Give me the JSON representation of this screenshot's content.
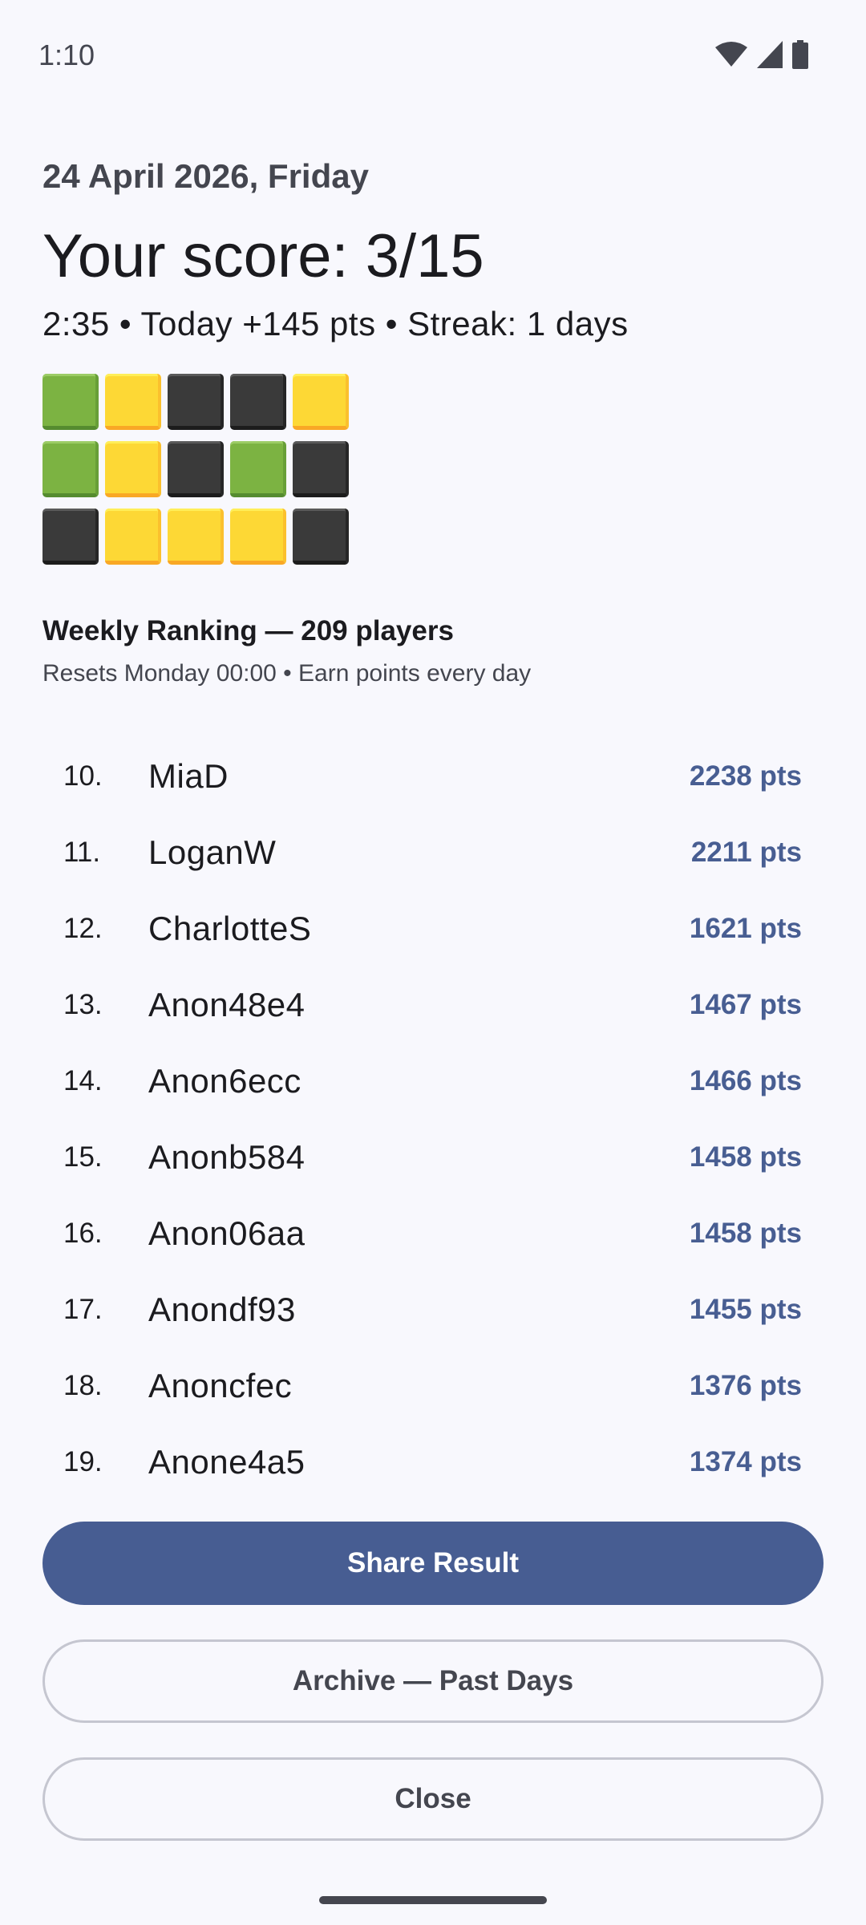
{
  "status_bar": {
    "time": "1:10",
    "icons": [
      "wifi-icon",
      "cell-signal-icon",
      "battery-icon"
    ]
  },
  "header": {
    "date": "24 April 2026, Friday",
    "score": "Your score: 3/15",
    "meta": "2:35 • Today +145 pts • Streak: 1 days"
  },
  "result_grid": [
    [
      "green",
      "yellow",
      "black",
      "black",
      "yellow"
    ],
    [
      "green",
      "yellow",
      "black",
      "green",
      "black"
    ],
    [
      "black",
      "yellow",
      "yellow",
      "yellow",
      "black"
    ]
  ],
  "ranking": {
    "title": "Weekly Ranking — 209 players",
    "subtitle": "Resets Monday 00:00 • Earn points every day",
    "rows": [
      {
        "rank": "10.",
        "name": "MiaD",
        "points": "2238 pts"
      },
      {
        "rank": "11.",
        "name": "LoganW",
        "points": "2211 pts"
      },
      {
        "rank": "12.",
        "name": "CharlotteS",
        "points": "1621 pts"
      },
      {
        "rank": "13.",
        "name": "Anon48e4",
        "points": "1467 pts"
      },
      {
        "rank": "14.",
        "name": "Anon6ecc",
        "points": "1466 pts"
      },
      {
        "rank": "15.",
        "name": "Anonb584",
        "points": "1458 pts"
      },
      {
        "rank": "16.",
        "name": "Anon06aa",
        "points": "1458 pts"
      },
      {
        "rank": "17.",
        "name": "Anondf93",
        "points": "1455 pts"
      },
      {
        "rank": "18.",
        "name": "Anoncfec",
        "points": "1376 pts"
      },
      {
        "rank": "19.",
        "name": "Anone4a5",
        "points": "1374 pts"
      }
    ]
  },
  "buttons": {
    "share": "Share Result",
    "archive": "Archive — Past Days",
    "close": "Close"
  },
  "colors": {
    "background": "#f8f8fd",
    "primary": "#475d92",
    "points": "#485e92",
    "tile_green": "#7cb342",
    "tile_yellow": "#fdd835",
    "tile_black": "#3a3a3a"
  }
}
